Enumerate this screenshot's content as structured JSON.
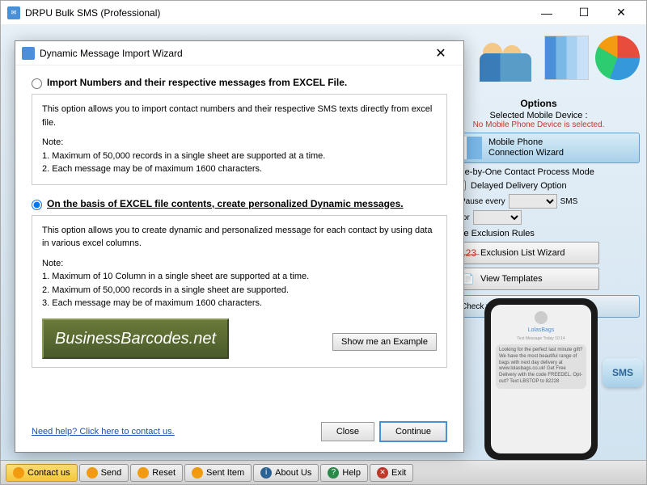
{
  "main": {
    "title": "DRPU Bulk SMS (Professional)",
    "min": "—",
    "max": "☐",
    "close": "✕"
  },
  "options": {
    "title": "Options",
    "device_label": "Selected Mobile Device :",
    "device_status": "No Mobile Phone Device is selected.",
    "conn_wizard_l1": "Mobile Phone",
    "conn_wizard_l2": "Connection  Wizard",
    "mode_label": "One-by-One Contact Process Mode",
    "delayed_label": "Delayed Delivery Option",
    "pause_label": "Pause every",
    "pause_suffix": "SMS",
    "for_label": "for",
    "exclusion_label": "Use Exclusion Rules",
    "exclusion_btn": "Exclusion List Wizard",
    "templates_btn": "View Templates",
    "check_device_btn": "Check your Android Device status"
  },
  "phone": {
    "contact": "LolasBags",
    "msg_header": "Text Message\nToday 10:14",
    "msg": "Looking for the perfect last minute gift? We have the most beautiful range of bags with next day delivery at www.lolasbags.co.uk! Get Free Delivery with the code FREEDEL.\n\nOpt-out? Text LBSTOP to 82228",
    "sms_label": "SMS"
  },
  "toolbar": {
    "contact": "Contact us",
    "send": "Send",
    "reset": "Reset",
    "sent_item": "Sent Item",
    "about": "About Us",
    "help": "Help",
    "exit": "Exit"
  },
  "dialog": {
    "title": "Dynamic Message Import Wizard",
    "close_x": "✕",
    "opt1_label": "Import Numbers and their respective messages from EXCEL File.",
    "opt1_desc": "This option allows you to import contact numbers and their respective SMS texts directly from excel file.",
    "opt1_note_title": "Note:",
    "opt1_note_1": "1. Maximum of 50,000 records in a single sheet are supported at a time.",
    "opt1_note_2": "2. Each message may be of maximum 1600 characters.",
    "opt2_label": "On the basis of EXCEL file contents, create personalized Dynamic messages.",
    "opt2_desc": "This option allows you to create dynamic and personalized message for each contact by using data in various excel columns.",
    "opt2_note_title": "Note:",
    "opt2_note_1": "1. Maximum of 10 Column in a single sheet are supported at a time.",
    "opt2_note_2": "2. Maximum of 50,000 records in a single sheet are supported.",
    "opt2_note_3": "3. Each message may be of maximum 1600 characters.",
    "watermark": "BusinessBarcodes.net",
    "example_btn": "Show me an Example",
    "help_link": "Need help? Click here to contact us.",
    "close_btn": "Close",
    "continue_btn": "Continue"
  }
}
